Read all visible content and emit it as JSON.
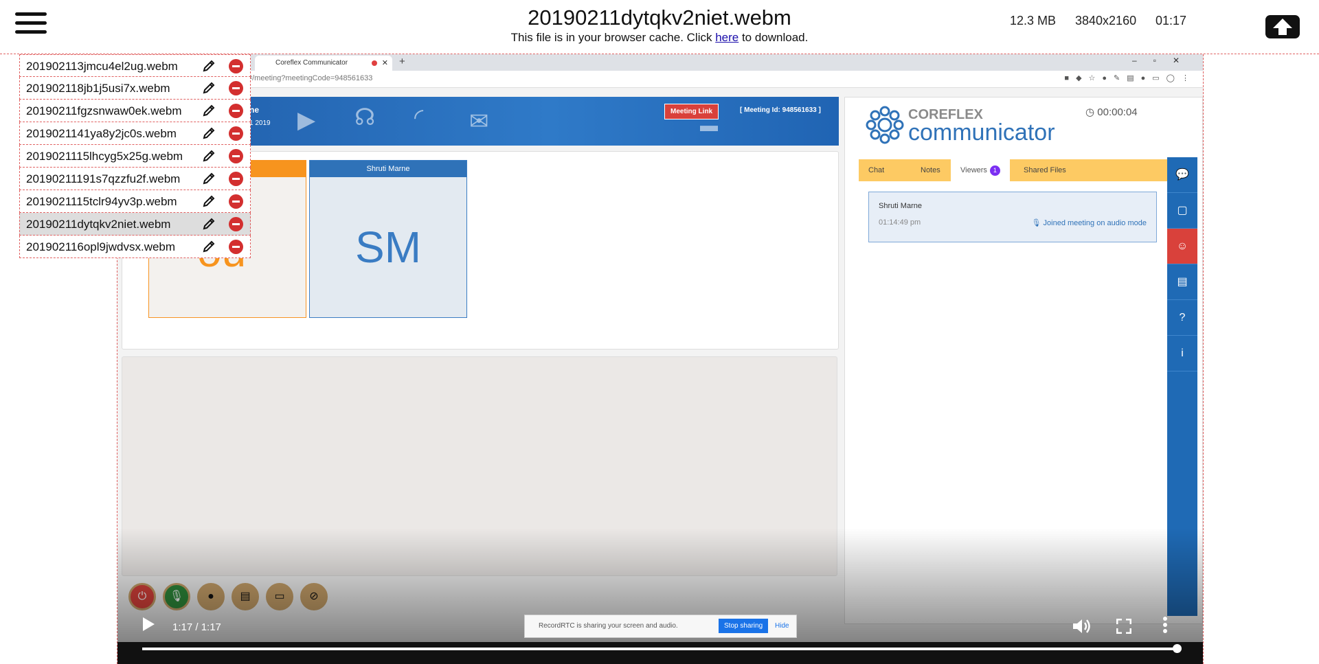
{
  "header": {
    "file_title": "20190211dytqkv2niet.webm",
    "cache_text_before": "This file is in your browser cache. Click ",
    "cache_link": "here",
    "cache_text_after": " to download.",
    "file_size": "12.3 MB",
    "resolution": "3840x2160",
    "duration": "01:17"
  },
  "file_list": [
    {
      "name": "201902113jmcu4el2ug.webm"
    },
    {
      "name": "201902118jb1j5usi7x.webm"
    },
    {
      "name": "20190211fgzsnwaw0ek.webm"
    },
    {
      "name": "2019021141ya8y2jc0s.webm"
    },
    {
      "name": "2019021115lhcyg5x25g.webm"
    },
    {
      "name": "20190211191s7qzzfu2f.webm"
    },
    {
      "name": "2019021115tclr94yv3p.webm"
    },
    {
      "name": "20190211dytqkv2niet.webm",
      "selected": true
    },
    {
      "name": "201902116opl9jwdvsx.webm"
    }
  ],
  "recording": {
    "tab_title": "Coreflex Communicator",
    "url": "#/meeting?meetingCode=948561633",
    "banner_name": "ne",
    "banner_date": "1 2019",
    "meeting_link": "Meeting Link",
    "meeting_id": "[ Meeting Id: 948561633 ]",
    "participant_you": "ou",
    "participant_sm_name": "Shruti Marne",
    "participant_sm_initials": "SM",
    "brand_top": "COREFLEX",
    "brand": "communicator",
    "timer": "00:00:04",
    "tabs": [
      "Chat",
      "Notes",
      "Viewers",
      "Shared Files"
    ],
    "viewers_badge": "1",
    "viewer_name": "Shruti Marne",
    "viewer_time": "01:14:49 pm",
    "viewer_status": "Joined meeting on audio mode",
    "sharing_text": "RecordRTC is sharing your screen and audio.",
    "stop_sharing": "Stop sharing",
    "hide": "Hide"
  },
  "player": {
    "time": "1:17 / 1:17",
    "progress_fraction": 1.0
  }
}
